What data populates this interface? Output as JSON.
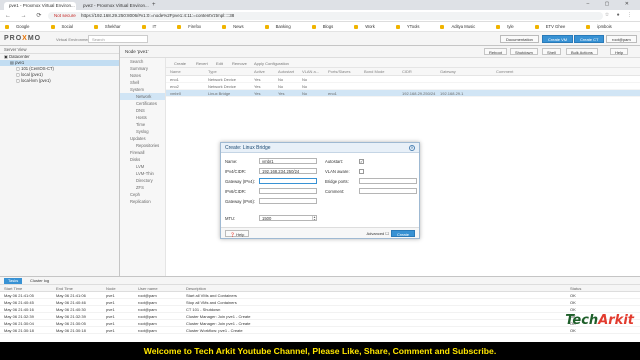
{
  "browser": {
    "tabs": [
      {
        "label": "pve1 - Proxmox Virtual Environ...",
        "active": true
      },
      {
        "label": "pve2 - Proxmox Virtual Environ...",
        "active": false
      }
    ],
    "security_label": "Not secure",
    "url": "https://192.168.29.250:8006/#v1:0:=node%2Fpve1:4:11:=contentVztmpl::::38",
    "bookmarks": [
      "Google",
      "Social",
      "Shekhar",
      "IT",
      "Firefox",
      "News",
      "Banking",
      "Blogs",
      "Work",
      "YTools",
      "Aditya Music",
      "tyle",
      "ETV Ghee",
      "ipmbois"
    ]
  },
  "pve": {
    "logo_prefix": "PRO",
    "logo_accent": "X",
    "logo_suffix": "MO",
    "version": "Virtual Environment 7.1-2",
    "search_placeholder": "Search",
    "header_buttons": [
      "Documentation",
      "Create VM",
      "Create CT",
      "root@pam"
    ]
  },
  "left": {
    "view": "Server View",
    "tree": [
      {
        "label": "Datacenter",
        "indent": 0,
        "selected": false
      },
      {
        "label": "pve1",
        "indent": 1,
        "selected": true
      },
      {
        "label": "101 (CentOS-CT)",
        "indent": 2,
        "selected": false
      },
      {
        "label": "local (pve1)",
        "indent": 2,
        "selected": false
      },
      {
        "label": "local-lvm (pve1)",
        "indent": 2,
        "selected": false
      }
    ]
  },
  "node": {
    "title": "Node 'pve1'",
    "buttons": [
      "Reboot",
      "Shutdown",
      "Shell",
      "Bulk Actions",
      "Help"
    ]
  },
  "submenu": [
    {
      "label": "Search",
      "sub": false,
      "active": false
    },
    {
      "label": "Summary",
      "sub": false,
      "active": false
    },
    {
      "label": "Notes",
      "sub": false,
      "active": false
    },
    {
      "label": "Shell",
      "sub": false,
      "active": false
    },
    {
      "label": "System",
      "sub": false,
      "active": false
    },
    {
      "label": "Network",
      "sub": true,
      "active": true
    },
    {
      "label": "Certificates",
      "sub": true,
      "active": false
    },
    {
      "label": "DNS",
      "sub": true,
      "active": false
    },
    {
      "label": "Hosts",
      "sub": true,
      "active": false
    },
    {
      "label": "Time",
      "sub": true,
      "active": false
    },
    {
      "label": "Syslog",
      "sub": true,
      "active": false
    },
    {
      "label": "Updates",
      "sub": false,
      "active": false
    },
    {
      "label": "Repositories",
      "sub": true,
      "active": false
    },
    {
      "label": "Firewall",
      "sub": false,
      "active": false
    },
    {
      "label": "Disks",
      "sub": false,
      "active": false
    },
    {
      "label": "LVM",
      "sub": true,
      "active": false
    },
    {
      "label": "LVM-Thin",
      "sub": true,
      "active": false
    },
    {
      "label": "Directory",
      "sub": true,
      "active": false
    },
    {
      "label": "ZFS",
      "sub": true,
      "active": false
    },
    {
      "label": "Ceph",
      "sub": false,
      "active": false
    },
    {
      "label": "Replication",
      "sub": false,
      "active": false
    }
  ],
  "network": {
    "toolbar": [
      "Create",
      "Revert",
      "Edit",
      "Remove",
      "Apply Configuration"
    ],
    "columns": [
      "Name",
      "Type",
      "Active",
      "Autostart",
      "VLAN a...",
      "Ports/Slaves",
      "Bond Mode",
      "CIDR",
      "Gateway",
      "Comment"
    ],
    "rows": [
      {
        "cells": [
          "eno1",
          "Network Device",
          "Yes",
          "No",
          "No",
          "",
          "",
          "",
          "",
          ""
        ],
        "selected": false
      },
      {
        "cells": [
          "eno2",
          "Network Device",
          "Yes",
          "No",
          "No",
          "",
          "",
          "",
          "",
          ""
        ],
        "selected": false
      },
      {
        "cells": [
          "vmbr0",
          "Linux Bridge",
          "Yes",
          "Yes",
          "No",
          "eno1",
          "",
          "192.168.29.250/24",
          "192.168.29.1",
          ""
        ],
        "selected": true
      }
    ]
  },
  "dialog": {
    "title": "Create: Linux Bridge",
    "name_label": "Name:",
    "name_value": "vmbr1",
    "ipv4_label": "IPv4/CIDR:",
    "ipv4_value": "192.168.234.250/24",
    "gw4_label": "Gateway (IPv4):",
    "gw4_value": "",
    "ipv6_label": "IPv6/CIDR:",
    "ipv6_value": "",
    "gw6_label": "Gateway (IPv6):",
    "gw6_value": "",
    "autostart_label": "Autostart:",
    "autostart_checked": true,
    "vlan_label": "VLAN aware:",
    "vlan_checked": false,
    "ports_label": "Bridge ports:",
    "ports_value": "",
    "comment_label": "Comment:",
    "comment_value": "",
    "mtu_label": "MTU:",
    "mtu_value": "1500",
    "help_label": "Help",
    "advanced_label": "Advanced",
    "create_label": "Create"
  },
  "log": {
    "tabs": [
      "Tasks",
      "Cluster log"
    ],
    "columns": [
      "Start Time",
      "End Time",
      "Node",
      "User name",
      "Description",
      "Status"
    ],
    "rows": [
      [
        "May 06 21:41:05",
        "May 06 21:41:06",
        "pve1",
        "root@pam",
        "Start all VMs and Containers",
        "OK"
      ],
      [
        "May 06 21:40:45",
        "May 06 21:40:46",
        "pve1",
        "root@pam",
        "Stop all VMs and Containers",
        "OK"
      ],
      [
        "May 06 21:40:16",
        "May 06 21:40:30",
        "pve1",
        "root@pam",
        "CT 101 - Shutdown",
        "OK"
      ],
      [
        "May 06 21:32:39",
        "May 06 21:32:39",
        "pve1",
        "root@pam",
        "Cluster Manager: Join pve1 - Create",
        "OK"
      ],
      [
        "May 06 21:30:04",
        "May 06 21:30:05",
        "pve1",
        "root@pam",
        "Cluster Manager: Join pve1 - Create",
        "OK"
      ],
      [
        "May 06 21:30:18",
        "May 06 21:30:18",
        "pve1",
        "root@pam",
        "Cluster Workflow: pve1 - Create",
        "OK"
      ]
    ]
  },
  "watermark": {
    "part1": "Tech",
    "part2": "Arkit"
  },
  "banner": "Welcome to Tech Arkit Youtube Channel, Please Like, Share, Comment and Subscribe."
}
